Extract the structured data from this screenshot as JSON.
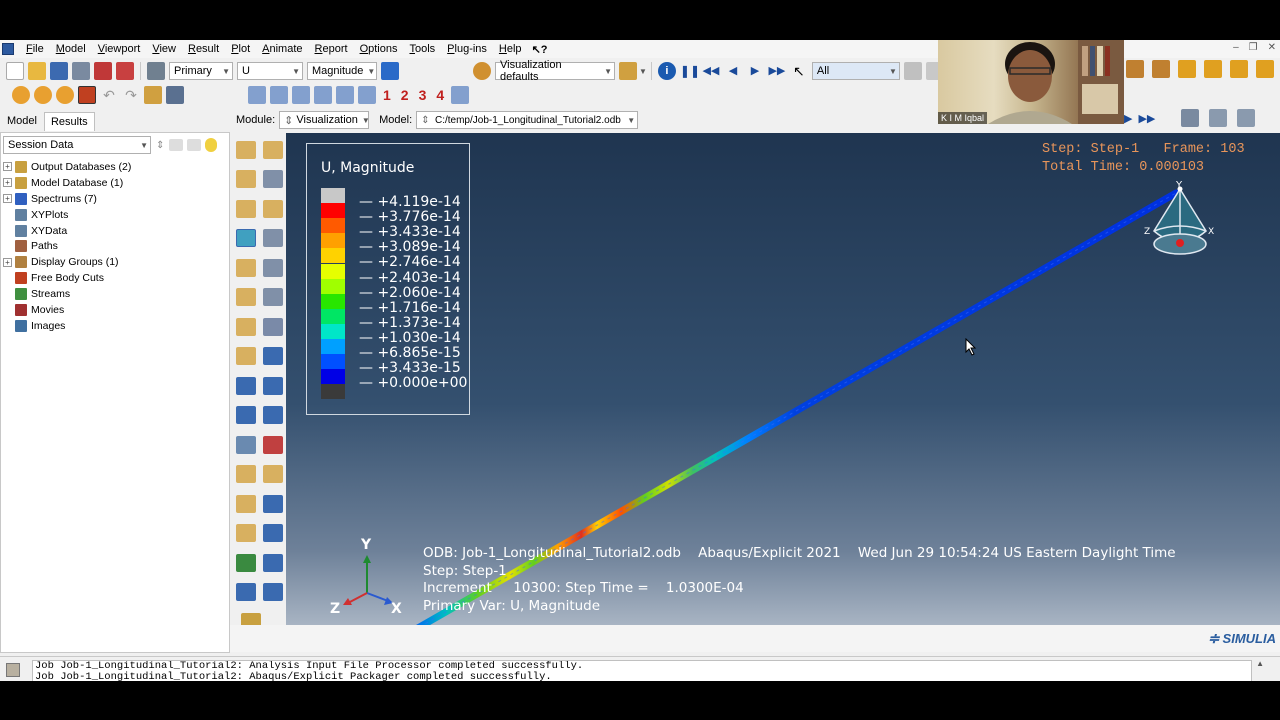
{
  "menu": [
    "File",
    "Model",
    "Viewport",
    "View",
    "Result",
    "Plot",
    "Animate",
    "Report",
    "Options",
    "Tools",
    "Plug-ins",
    "Help"
  ],
  "help_cursor": "↖?",
  "toolbar1": {
    "variable_type": "Primary",
    "variable": "U",
    "invariant": "Magnitude",
    "visualization_defaults": "Visualization defaults",
    "selection_filter": "All"
  },
  "toolbar2": {
    "numbers": [
      "1",
      "2",
      "3",
      "4"
    ]
  },
  "tabs": [
    "Model",
    "Results"
  ],
  "module_row": {
    "module_label": "Module:",
    "module_value": "Visualization",
    "model_label": "Model:",
    "model_value": "C:/temp/Job-1_Longitudinal_Tutorial2.odb"
  },
  "tree": {
    "header": "Session Data",
    "items": [
      {
        "label": "Output Databases (2)",
        "expandable": true,
        "icon_color": "#c8a040"
      },
      {
        "label": "Model Database (1)",
        "expandable": true,
        "icon_color": "#c8a040"
      },
      {
        "label": "Spectrums (7)",
        "expandable": true,
        "icon_color": "#3060c0"
      },
      {
        "label": "XYPlots",
        "expandable": false,
        "icon_color": "#6080a0"
      },
      {
        "label": "XYData",
        "expandable": false,
        "icon_color": "#6080a0"
      },
      {
        "label": "Paths",
        "expandable": false,
        "icon_color": "#a06040"
      },
      {
        "label": "Display Groups (1)",
        "expandable": true,
        "icon_color": "#b08040"
      },
      {
        "label": "Free Body Cuts",
        "expandable": false,
        "icon_color": "#c04020"
      },
      {
        "label": "Streams",
        "expandable": false,
        "icon_color": "#409040"
      },
      {
        "label": "Movies",
        "expandable": false,
        "icon_color": "#a03030"
      },
      {
        "label": "Images",
        "expandable": false,
        "icon_color": "#4070a0"
      }
    ]
  },
  "legend": {
    "title": "U, Magnitude",
    "values": [
      "+4.119e-14",
      "+3.776e-14",
      "+3.433e-14",
      "+3.089e-14",
      "+2.746e-14",
      "+2.403e-14",
      "+2.060e-14",
      "+1.716e-14",
      "+1.373e-14",
      "+1.030e-14",
      "+6.865e-15",
      "+3.433e-15",
      "+0.000e+00"
    ],
    "colors": [
      "#c8c8c8",
      "#ff0000",
      "#ff5a00",
      "#ffa000",
      "#ffd200",
      "#e6ff00",
      "#a0ff00",
      "#28e600",
      "#00e664",
      "#00e6c8",
      "#00a0ff",
      "#0050ff",
      "#0000e6",
      "#3a3a3a"
    ]
  },
  "step_info": {
    "step": "Step: Step-1",
    "frame": "Frame: 103",
    "total_time": "Total Time: 0.000103"
  },
  "triad_small": {
    "y": "Y",
    "z": "Z",
    "x": "X"
  },
  "triad_main": {
    "y": "Y",
    "z": "Z",
    "x": "X"
  },
  "state_block": {
    "odb": "ODB: Job-1_Longitudinal_Tutorial2.odb",
    "solver": "Abaqus/Explicit 2021",
    "date": "Wed Jun 29 10:54:24 US Eastern Daylight Time",
    "step": "Step: Step-1",
    "increment": "Increment     10300: Step Time =    1.0300E-04",
    "primary_var": "Primary Var: U, Magnitude"
  },
  "brand": "SIMULIA",
  "messages": [
    "Job Job-1_Longitudinal_Tutorial2: Analysis Input File Processor completed successfully.",
    "Job Job-1_Longitudinal_Tutorial2: Abaqus/Explicit Packager completed successfully."
  ],
  "webcam": {
    "name": "K I M Iqbal"
  }
}
